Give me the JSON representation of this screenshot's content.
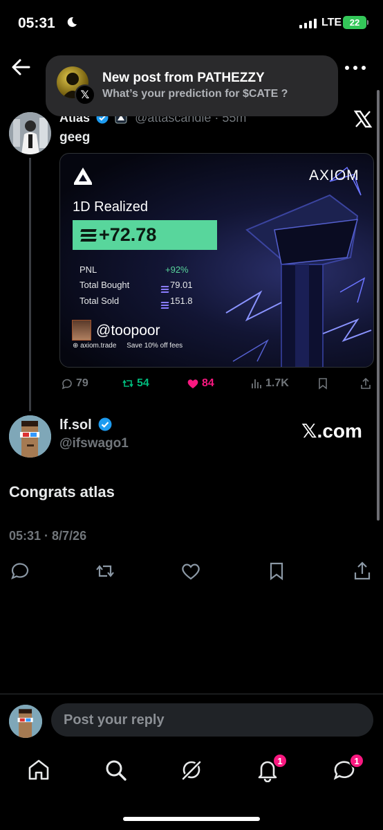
{
  "status_bar": {
    "time": "05:31",
    "network": "LTE",
    "battery": "22"
  },
  "notification": {
    "title": "New post from PATHEZZY",
    "body": "What’s your prediction for $CATE ?",
    "badge_glyph": "𝕏"
  },
  "parent_tweet": {
    "name": "Atlas",
    "handle": "@attascandle · 55m",
    "text": "geeg",
    "card": {
      "brand": "AXIOM",
      "period": "1D Realized",
      "pnl_value": "+72.78",
      "stats": [
        {
          "label": "PNL",
          "value": "+92%"
        },
        {
          "label": "Total Bought",
          "value": "79.01"
        },
        {
          "label": "Total Sold",
          "value": "151.8"
        }
      ],
      "user": "@toopoor",
      "site": "axiom.trade",
      "promo": "Save 10% off fees"
    },
    "actions": {
      "replies": "79",
      "reposts": "54",
      "likes": "84",
      "views": "1.7K"
    },
    "colors": {
      "repost": "#00ba7c",
      "like": "#f91880",
      "muted": "#71767b"
    }
  },
  "main_tweet": {
    "name": "lf.sol",
    "handle": "@ifswago1",
    "watermark": "𝕏.com",
    "text": "Congrats atlas",
    "timestamp": "05:31 · 8/7/26"
  },
  "reply": {
    "placeholder": "Post your reply"
  },
  "nav": {
    "notifications_badge": "1",
    "messages_badge": "1"
  },
  "accent": "#1d9bf0"
}
